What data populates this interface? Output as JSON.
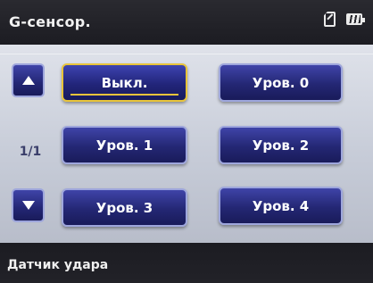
{
  "header": {
    "title": "G-сенсор.",
    "icons": [
      "sd-card-icon",
      "battery-icon"
    ]
  },
  "pager": {
    "up_icon": "arrow-up-icon",
    "down_icon": "arrow-down-icon",
    "page_indicator": "1/1"
  },
  "options": [
    {
      "label": "Выкл.",
      "selected": true
    },
    {
      "label": "Уров. 0",
      "selected": false
    },
    {
      "label": "Уров. 1",
      "selected": false
    },
    {
      "label": "Уров. 2",
      "selected": false
    },
    {
      "label": "Уров. 3",
      "selected": false
    },
    {
      "label": "Уров. 4",
      "selected": false
    }
  ],
  "footer": {
    "status": "Датчик удара"
  },
  "colors": {
    "button": "#242774",
    "button_border": "#9ea6dc",
    "selected_border": "#e8c43a",
    "panel": "#d4d8e2"
  }
}
